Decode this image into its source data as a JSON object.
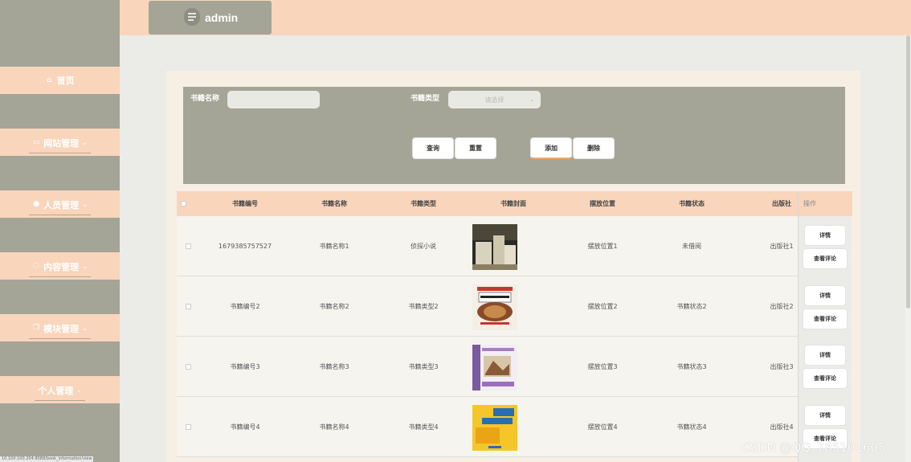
{
  "header": {
    "brand": "admin"
  },
  "sidebar": {
    "items": [
      {
        "label": "首页",
        "icon": "home-icon"
      },
      {
        "label": "网站管理",
        "icon": "monitor-icon"
      },
      {
        "label": "人员管理",
        "icon": "user-icon"
      },
      {
        "label": "内容管理",
        "icon": "chat-icon"
      },
      {
        "label": "模块管理",
        "icon": "copy-icon"
      },
      {
        "label": "个人管理",
        "icon": ""
      }
    ]
  },
  "search": {
    "name_label": "书籍名称",
    "name_value": "",
    "type_label": "书籍类型",
    "type_placeholder": "请选择",
    "query": "查询",
    "reset": "重置",
    "add": "添加",
    "delete": "删除"
  },
  "table": {
    "columns": [
      "书籍编号",
      "书籍名称",
      "书籍类型",
      "书籍封面",
      "摆放位置",
      "书籍状态",
      "出版社"
    ],
    "ops_header": "操作",
    "rows": [
      {
        "id": "1679385757527",
        "name": "书籍名称1",
        "type": "侦探小说",
        "location": "摆放位置1",
        "status": "未借阅",
        "publisher": "出版社1"
      },
      {
        "id": "书籍编号2",
        "name": "书籍名称2",
        "type": "书籍类型2",
        "location": "摆放位置2",
        "status": "书籍状态2",
        "publisher": "出版社2"
      },
      {
        "id": "书籍编号3",
        "name": "书籍名称3",
        "type": "书籍类型3",
        "location": "摆放位置3",
        "status": "书籍状态3",
        "publisher": "出版社3"
      },
      {
        "id": "书籍编号4",
        "name": "书籍名称4",
        "type": "书籍类型4",
        "location": "摆放位置4",
        "status": "书籍状态4",
        "publisher": "出版社4"
      }
    ],
    "detail": "详情",
    "comments": "查看评论"
  },
  "statusbar": {
    "url": "10.100.100.204:8088/book_information/view"
  },
  "watermark": "CSDN @QQ_785101605",
  "colors": {
    "accent": "#f9d5bb",
    "sidebar": "#a4a596",
    "panel": "#f8efe4"
  }
}
